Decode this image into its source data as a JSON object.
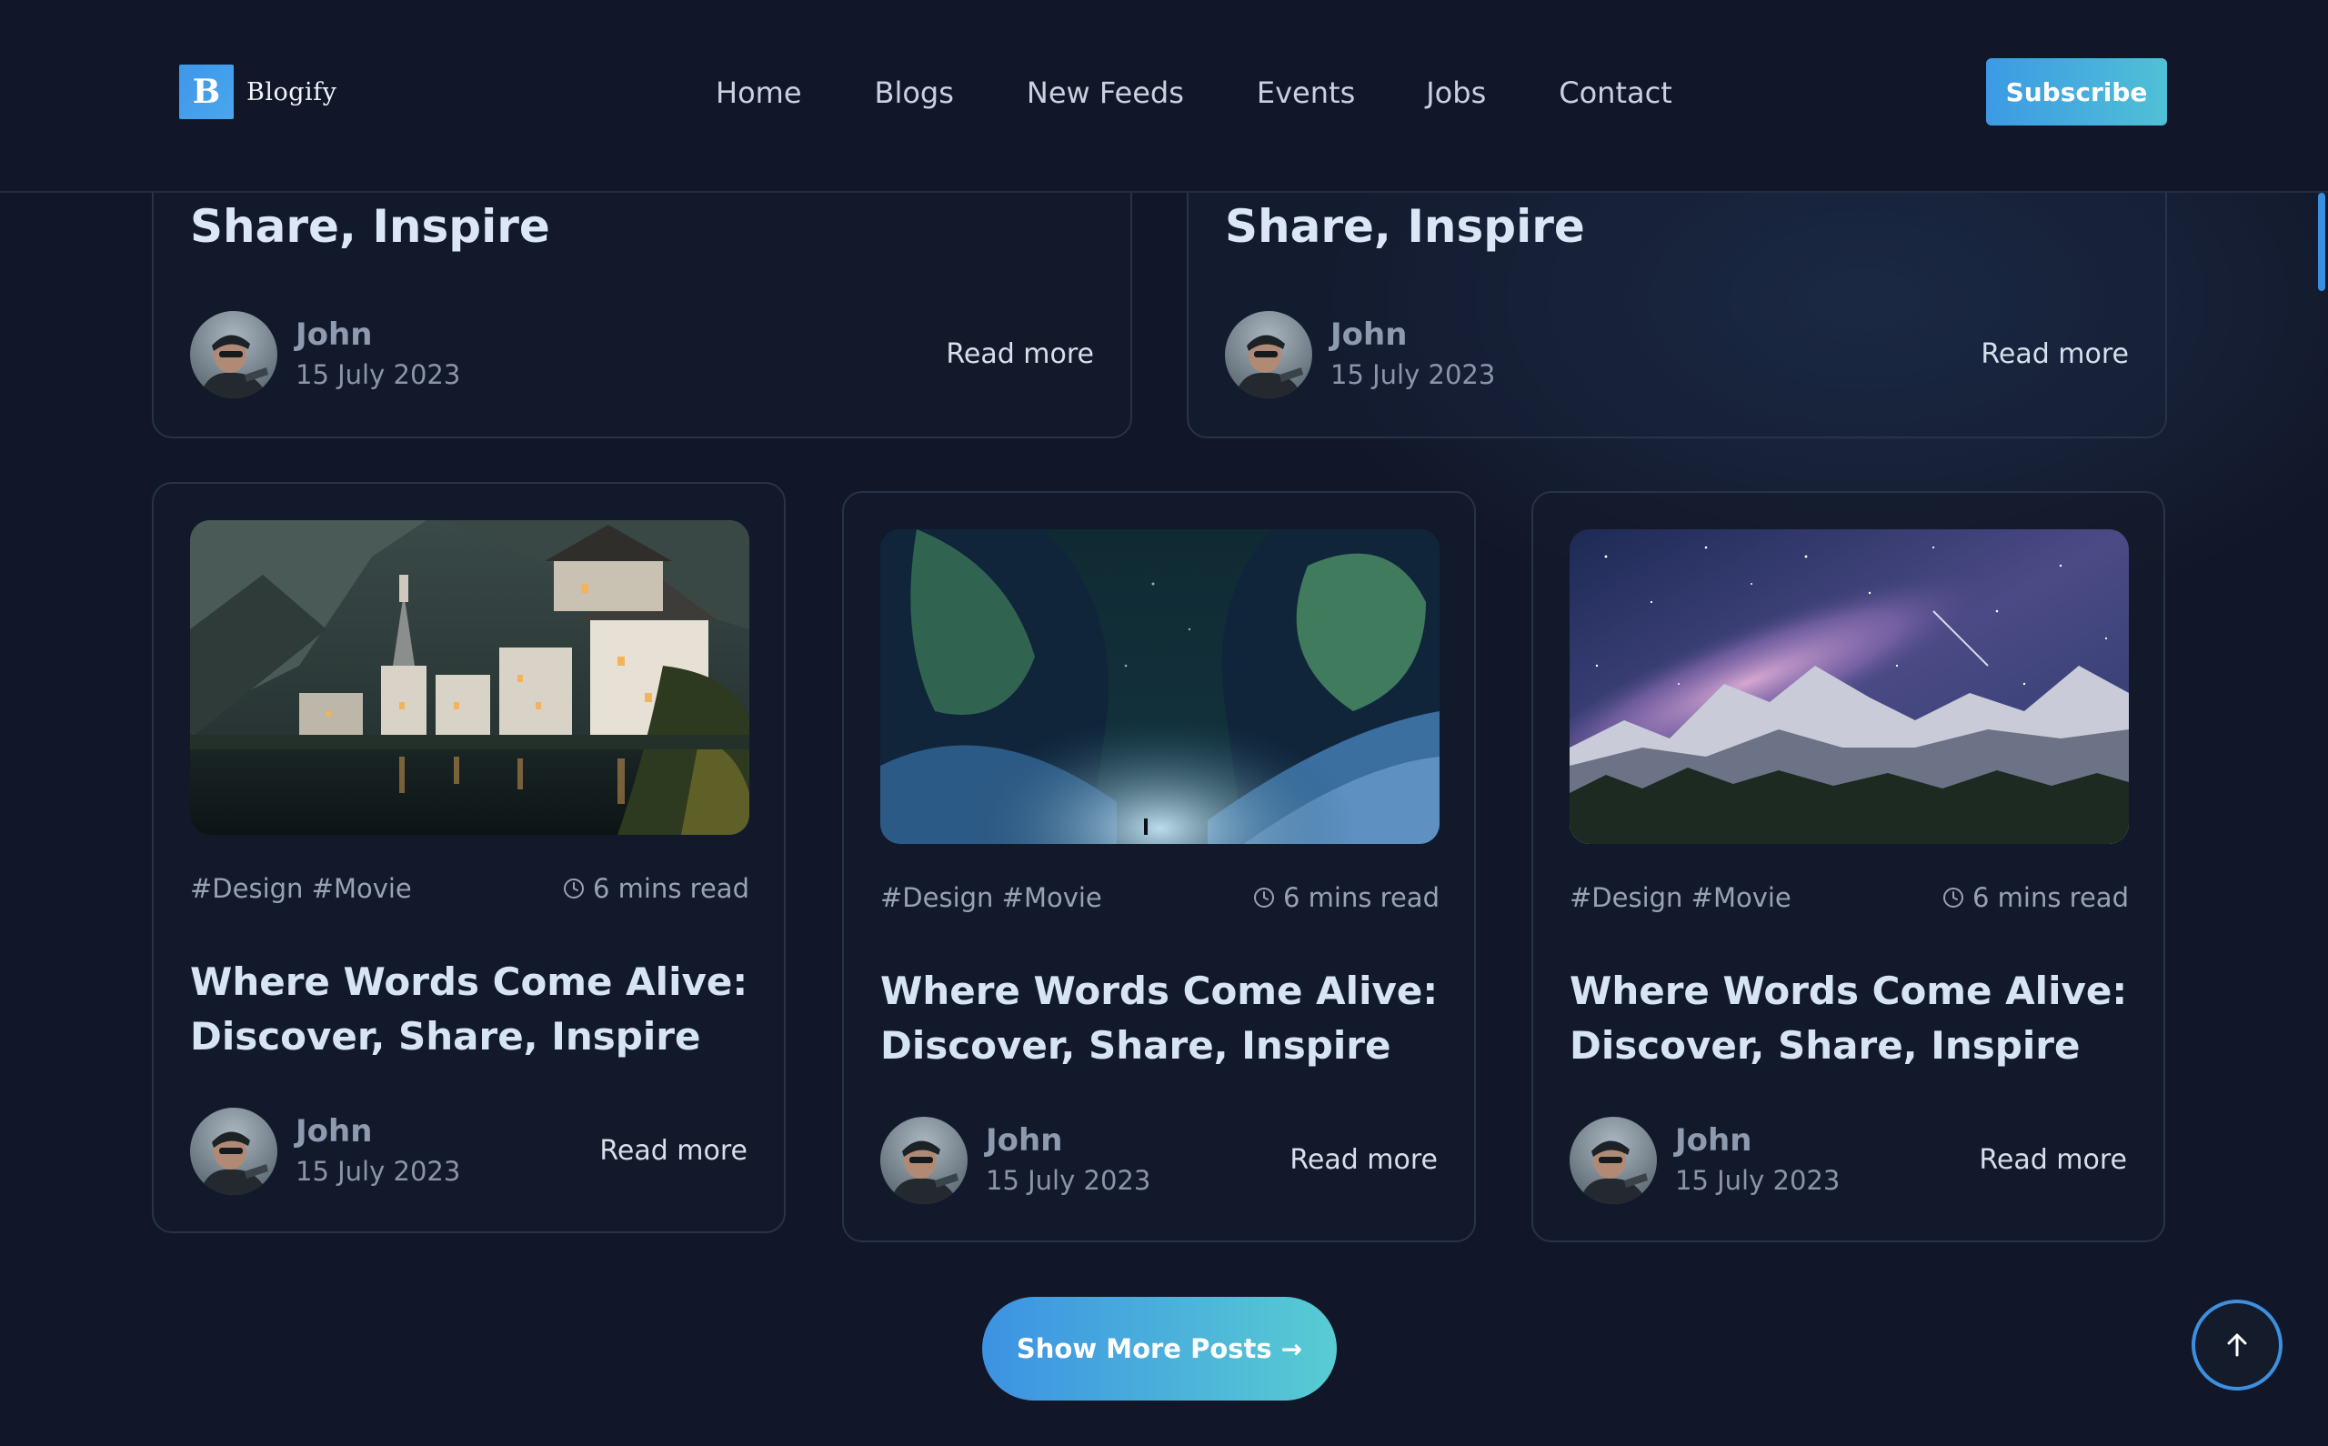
{
  "brand": {
    "logo_letter": "B",
    "name": "Blogify",
    "accent": "#3f97e8"
  },
  "nav": {
    "items": [
      {
        "label": "Home"
      },
      {
        "label": "Blogs"
      },
      {
        "label": "New Feeds"
      },
      {
        "label": "Events"
      },
      {
        "label": "Jobs"
      },
      {
        "label": "Contact"
      }
    ]
  },
  "header": {
    "subscribe_label": "Subscribe"
  },
  "top_cards": [
    {
      "title": "Share, Inspire",
      "author": "John",
      "date": "15 July 2023",
      "read_more": "Read more"
    },
    {
      "title": "Share, Inspire",
      "author": "John",
      "date": "15 July 2023",
      "read_more": "Read more"
    }
  ],
  "posts": [
    {
      "image": "lakeside-village-icon",
      "tags": "#Design #Movie",
      "read_time": "6 mins read",
      "title": "Where Words Come Alive: Discover, Share, Inspire",
      "author": "John",
      "date": "15 July 2023",
      "read_more": "Read more"
    },
    {
      "image": "aurora-canyon-icon",
      "tags": "#Design #Movie",
      "read_time": "6 mins read",
      "title": "Where Words Come Alive: Discover, Share, Inspire",
      "author": "John",
      "date": "15 July 2023",
      "read_more": "Read more"
    },
    {
      "image": "milky-way-mountains-icon",
      "tags": "#Design #Movie",
      "read_time": "6 mins read",
      "title": "Where Words Come Alive: Discover, Share, Inspire",
      "author": "John",
      "date": "15 July 2023",
      "read_more": "Read more"
    }
  ],
  "footer": {
    "show_more_label": "Show More Posts",
    "show_more_icon": "arrow-right-icon",
    "back_to_top_icon": "arrow-up-icon"
  }
}
